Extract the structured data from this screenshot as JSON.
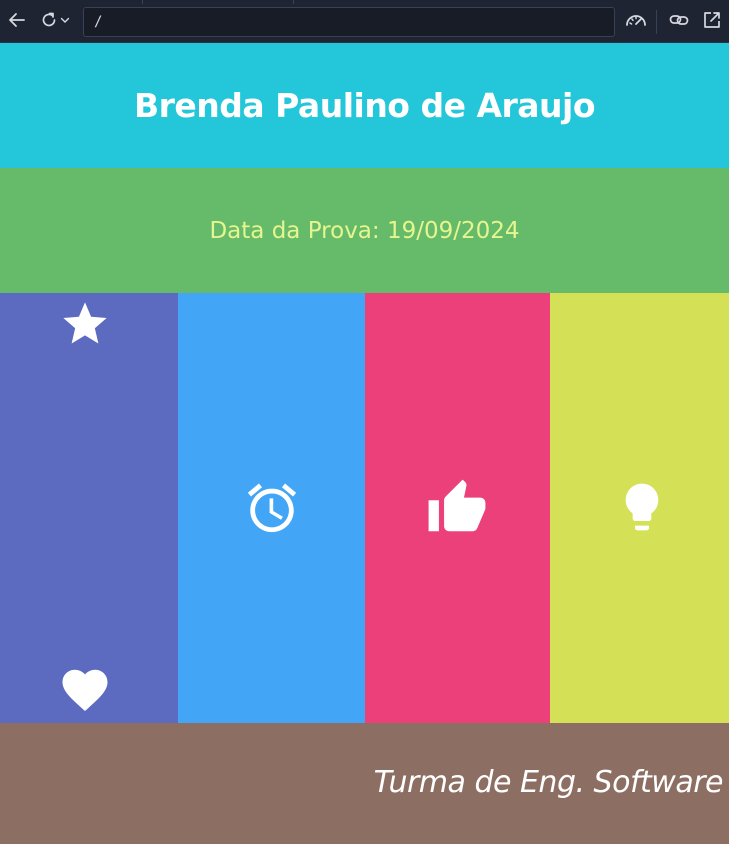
{
  "browser": {
    "url": "/",
    "icons": [
      "back-icon",
      "reload-icon",
      "chevron-down-icon",
      "dashboard-gauge-icon",
      "link-icon",
      "open-external-icon"
    ]
  },
  "page": {
    "title": "Brenda Paulino de Araujo",
    "date_line": "Data da Prova: 19/09/2024",
    "footer_text": "Turma de Eng. Software",
    "columns": [
      {
        "color": "#5c6bc0",
        "icons": [
          "star-icon",
          "heart-icon"
        ]
      },
      {
        "color": "#42a5f5",
        "icons": [
          "alarm-clock-icon"
        ]
      },
      {
        "color": "#ec407a",
        "icons": [
          "thumbs-up-icon"
        ]
      },
      {
        "color": "#d4e157",
        "icons": [
          "lightbulb-icon"
        ]
      }
    ],
    "colors": {
      "header": "#24c6da",
      "date_band": "#66bb6a",
      "date_text": "#e6f58f",
      "footer": "#8d6e63"
    }
  }
}
